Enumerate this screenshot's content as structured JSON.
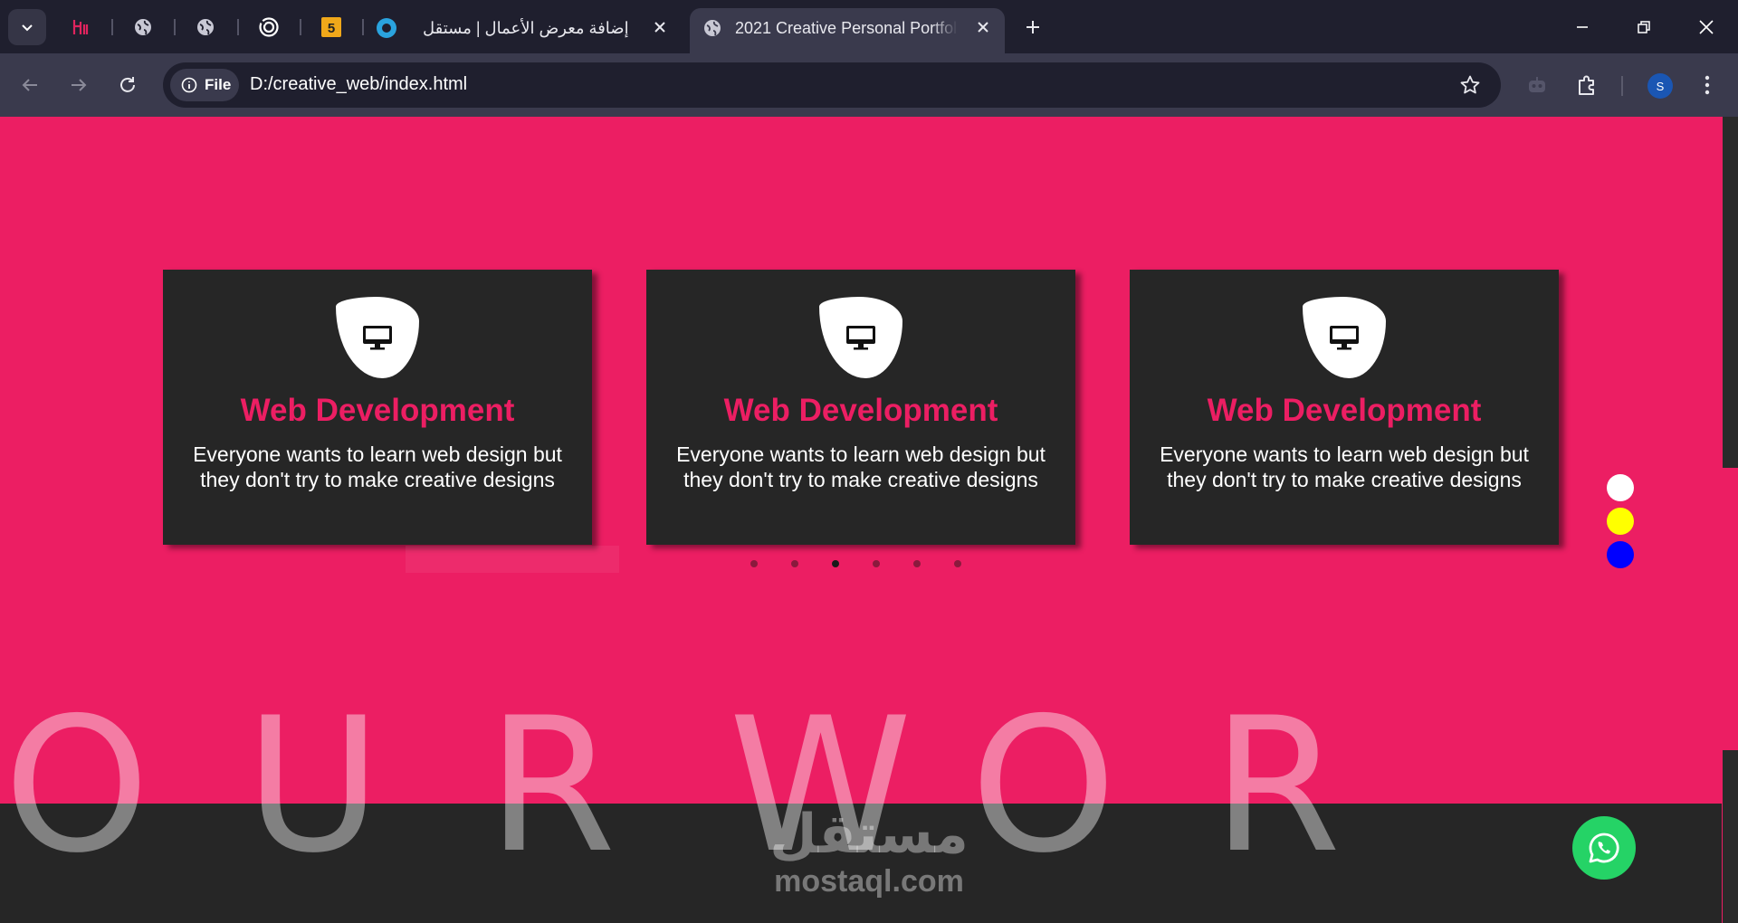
{
  "browser": {
    "tabs": [
      {
        "title": "إضافة معرض الأعمال | مستقل",
        "active": false,
        "icon": "circle-logo-icon"
      },
      {
        "title": "2021 Creative Personal Portfolio",
        "active": true,
        "icon": "globe-icon"
      }
    ],
    "pinned_icons": [
      "h-logo-icon",
      "globe-icon",
      "globe-icon",
      "spiral-icon",
      "html5-icon"
    ],
    "address": {
      "chip": "File",
      "url": "D:/creative_web/index.html"
    },
    "profile_initial": "S"
  },
  "page": {
    "cards": [
      {
        "title": "Web Development",
        "text": "Everyone wants to learn web design but they don't try to make creative designs",
        "icon": "monitor-icon"
      },
      {
        "title": "Web Development",
        "text": "Everyone wants to learn web design but they don't try to make creative designs",
        "icon": "monitor-icon"
      },
      {
        "title": "Web Development",
        "text": "Everyone wants to learn web design but they don't try to make creative designs",
        "icon": "monitor-icon"
      }
    ],
    "carousel": {
      "count": 6,
      "active_index": 2
    },
    "theme_swatches": [
      "#ffffff",
      "#ffff00",
      "#0000ff"
    ],
    "big_letters": [
      "O",
      "U",
      "R",
      "W",
      "O",
      "R"
    ],
    "watermark": {
      "arabic": "مستقل",
      "latin": "mostaql.com"
    },
    "colors": {
      "accent": "#ec1e63",
      "card_bg": "#262626",
      "whatsapp": "#25d366"
    }
  }
}
